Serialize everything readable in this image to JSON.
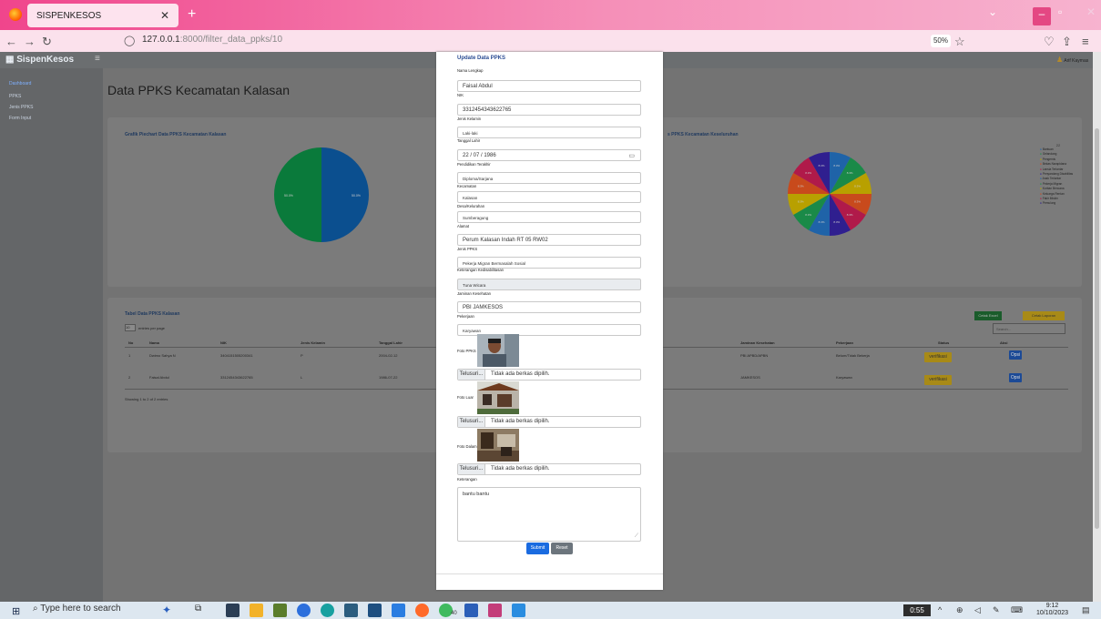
{
  "browser": {
    "tab_title": "SISPENKESOS",
    "url_host": "127.0.0.1",
    "url_rest": ":8000/filter_data_ppks/10",
    "zoom": "50%"
  },
  "app": {
    "brand": "SispenKesos",
    "user": "Arif Kaymas",
    "page_title": "Data PPKS Kecamatan Kalasan",
    "menu": [
      "Dashboard",
      "PPKS",
      "Jenis PPKS",
      "Form Input"
    ],
    "chart1_title": "Grafik Piechart Data PPKS Kecamatan Kalasan",
    "chart2_title": "s PPKS Kecamatan Keseluruhan",
    "table_title": "Tabel Data PPKS Kalasan",
    "entries_label": "entries per page",
    "entries_value": "10",
    "btn_cetak_excel": "Cetak Excel",
    "btn_cetak_laporan": "Cetak Laporan",
    "search_placeholder": "Search...",
    "headers_left": [
      "No",
      "Nama",
      "NIK",
      "Jenis Kelamin",
      "Tanggal Lahir"
    ],
    "headers_right": [
      "Jaminan Kesehatan",
      "Pekerjaan",
      "Status",
      "Aksi"
    ],
    "rows": [
      {
        "no": "1",
        "nama": "Dwimo Sahya N",
        "nik": "3404151505200341",
        "jk": "P",
        "tgl": "2004-02-12",
        "jaminan": "PBI APBD/APBN",
        "pekerjaan": "Belum/Tidak Bekerja",
        "status": "verifikasi",
        "aksi": "Opsi"
      },
      {
        "no": "2",
        "nama": "Faisal Abdul",
        "nik": "3312454343622765",
        "jk": "L",
        "tgl": "1986-07-22",
        "jaminan": "JAMKESOS",
        "pekerjaan": "Karyawan",
        "status": "verifikasi",
        "aksi": "Opsi"
      }
    ],
    "showing": "Showing 1 to 2 of 2 entries",
    "pie1": [
      {
        "label": "50.0%",
        "value": 50,
        "color": "#0b4f8f"
      },
      {
        "label": "50.0%",
        "value": 50,
        "color": "#0a7a3b"
      }
    ],
    "pie2_colors": [
      "#1f63a8",
      "#1a8a48",
      "#b8a000",
      "#c84a1c",
      "#b01a4a",
      "#2f1f8f",
      "#1f63a8",
      "#1a8a48",
      "#b8a000",
      "#c84a1c",
      "#b01a4a",
      "#2f1f8f"
    ],
    "pie2_labels": [
      "8.3%",
      "8.3%",
      "8.3%",
      "8.3%",
      "8.3%",
      "8.3%",
      "8.3%",
      "8.3%",
      "8.3%",
      "8.3%",
      "8.3%",
      "8.3%"
    ],
    "legend_title": "22",
    "legend": [
      "Bantuan",
      "Gelandang",
      "Pengemis",
      "Bekas Narapidana",
      "Lansia Terlantar",
      "Penyandang Disabilitas",
      "Anak Terlantar",
      "Pekerja Migran",
      "Korban Bencana",
      "Keluarga Rentan",
      "Fakir Miskin",
      "Pemulung"
    ]
  },
  "modal": {
    "title": "Update Data PPKS",
    "fields": [
      {
        "label": "Nama Lengkap",
        "value": "Faisal Abdul"
      },
      {
        "label": "NIK",
        "value": "3312454343622765"
      },
      {
        "label": "Jenis Kelamin",
        "value": "Laki-laki"
      },
      {
        "label": "Tanggal Lahir",
        "value": "22 / 07 / 1986"
      },
      {
        "label": "Pendidikan Terakhir",
        "value": "Diploma/Sarjana"
      },
      {
        "label": "Kecamatan",
        "value": "Kalasan"
      },
      {
        "label": "Desa/Kelurahan",
        "value": "Sumberagung"
      },
      {
        "label": "Alamat",
        "value": "Perum Kalasan Indah RT 05 RW02"
      },
      {
        "label": "Jenis PPKS",
        "value": "Pekerja Migran Bermasalah Sosial"
      },
      {
        "label": "Keterangan Kedisabilitasan",
        "value": "Tuna Wicara"
      },
      {
        "label": "Jaminan Kesehatan",
        "value": "PBI JAMKESOS"
      },
      {
        "label": "Pekerjaan",
        "value": "Karyawan"
      }
    ],
    "photo_labels": [
      "Foto PPKS",
      "Foto Luar",
      "Foto Dalam"
    ],
    "browse": "Telusuri...",
    "no_file": "Tidak ada berkas dipilih.",
    "keterangan_label": "Keterangan",
    "keterangan_value": "bantu bantu",
    "submit": "Submit",
    "reset": "Reset"
  },
  "taskbar": {
    "search": "Type here to search",
    "time": "9:12",
    "date": "10/10/2023",
    "clock_badge": "0:55",
    "chat_count": "40"
  }
}
